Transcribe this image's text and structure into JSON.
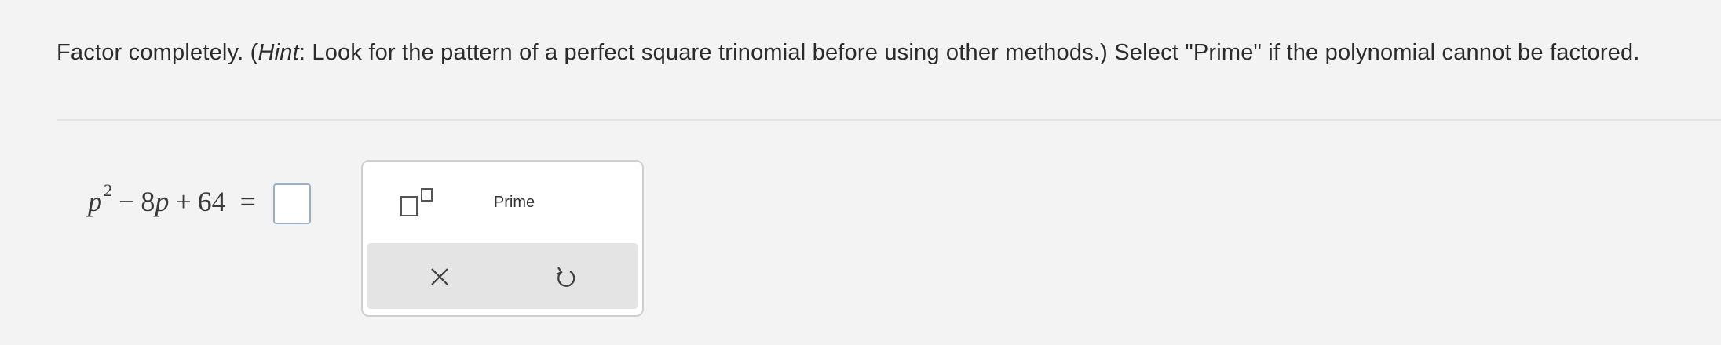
{
  "instructions": {
    "part1": "Factor completely. (",
    "hint_word": "Hint",
    "part2": ": Look for the pattern of a perfect square trinomial before using other methods.) Select \"Prime\" if the polynomial cannot be factored."
  },
  "equation": {
    "var": "p",
    "exponent": "2",
    "minus": "−",
    "coefficient": "8",
    "var2": "p",
    "plus": "+",
    "constant": "64",
    "equals": "="
  },
  "answer": {
    "value": ""
  },
  "palette": {
    "exponent_button_icon": "exponent-template-icon",
    "prime_label": "Prime",
    "clear_icon": "close-x-icon",
    "undo_icon": "undo-icon"
  },
  "colors": {
    "background": "#f3f3f3",
    "answer_border": "#9ab0c2",
    "action_bar": "#e4e4e4"
  }
}
